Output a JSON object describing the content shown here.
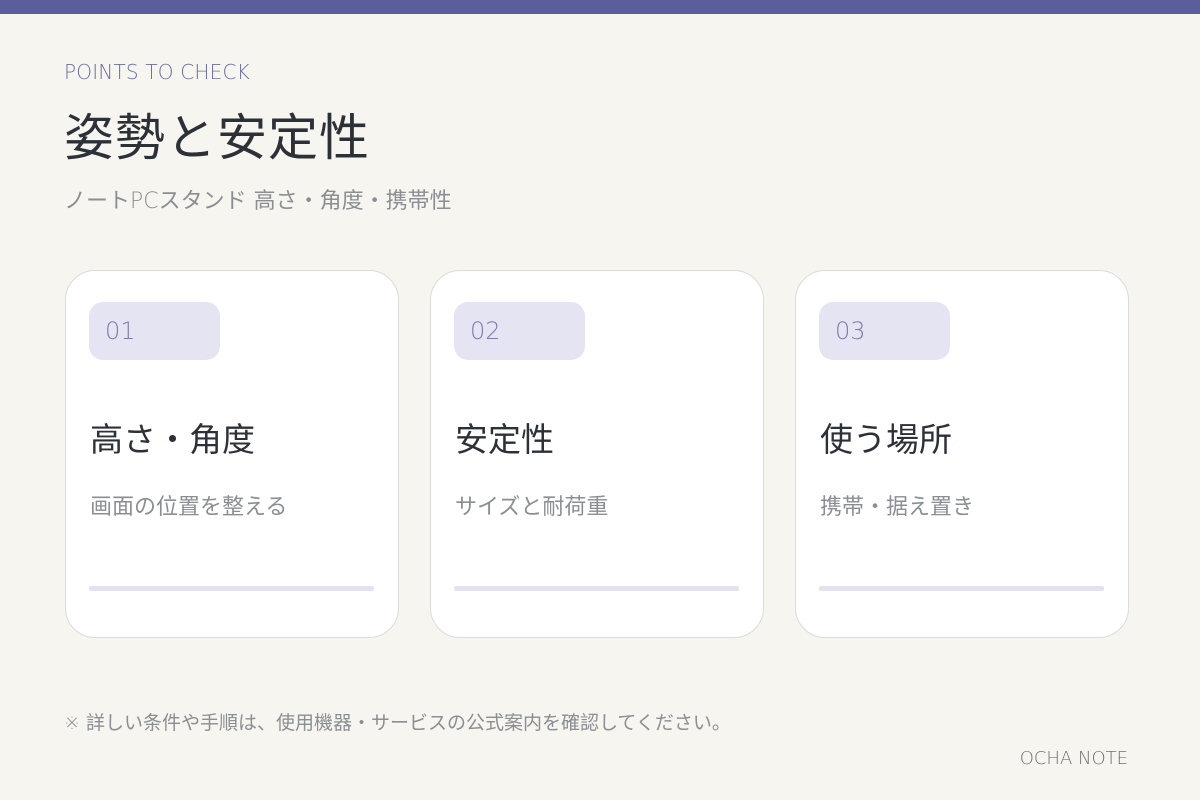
{
  "colors": {
    "accent": "#5a5e9c",
    "background": "#f6f5f0",
    "badge_bg": "#e5e4f3",
    "card_bg": "#ffffff",
    "text_primary": "#2c3138",
    "text_secondary": "#8b8e92"
  },
  "header": {
    "eyebrow": "POINTS TO CHECK",
    "title": "姿勢と安定性",
    "subtitle": "ノートPCスタンド 高さ・角度・携帯性"
  },
  "cards": [
    {
      "number": "01",
      "title": "高さ・角度",
      "description": "画面の位置を整える"
    },
    {
      "number": "02",
      "title": "安定性",
      "description": "サイズと耐荷重"
    },
    {
      "number": "03",
      "title": "使う場所",
      "description": "携帯・据え置き"
    }
  ],
  "footer": {
    "note": "※ 詳しい条件や手順は、使用機器・サービスの公式案内を確認してください。",
    "brand": "OCHA NOTE"
  }
}
